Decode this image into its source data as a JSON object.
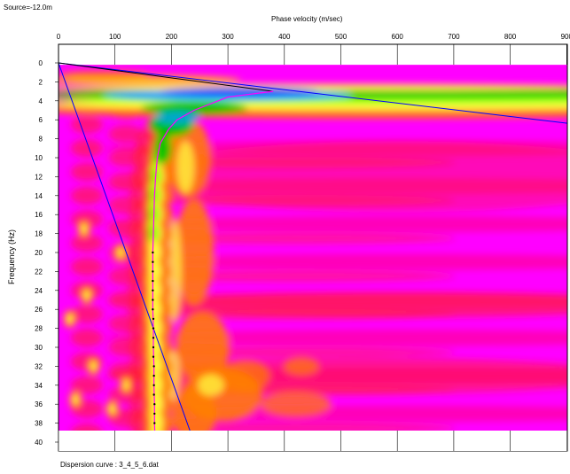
{
  "header": {
    "source_label": "Source=-12.0m"
  },
  "footer": {
    "dispersion_label": "Dispersion curve : 3_4_5_6.dat"
  },
  "chart_data": {
    "type": "heatmap",
    "title": "",
    "xlabel": "Phase velocity (m/sec)",
    "ylabel": "Frequency (Hz)",
    "xlim": [
      0,
      920
    ],
    "ylim": [
      0,
      40
    ],
    "x_ticks": [
      0,
      100,
      200,
      300,
      400,
      500,
      600,
      700,
      800,
      900
    ],
    "y_ticks": [
      0,
      2,
      4,
      6,
      8,
      10,
      12,
      14,
      16,
      18,
      20,
      22,
      24,
      26,
      28,
      30,
      32,
      34,
      36,
      38,
      40
    ],
    "y_inverted": true,
    "colormap": [
      "#ff00ff",
      "#ff0080",
      "#ff2030",
      "#ff8000",
      "#ffc800",
      "#ffff40",
      "#80ff00",
      "#00c000",
      "#00a0ff",
      "#0000ff"
    ],
    "colors": {
      "dispersion_curve": "#ff00ff",
      "picked_points": "#000000",
      "aliasing_lines": "#0000ff",
      "dark_line": "#000000"
    },
    "fundamental_mode": {
      "name": "Dispersion curve",
      "points": [
        [
          380,
          3
        ],
        [
          300,
          3.6
        ],
        [
          240,
          5
        ],
        [
          210,
          6
        ],
        [
          195,
          7
        ],
        [
          180,
          8.5
        ],
        [
          175,
          10
        ],
        [
          172,
          12
        ],
        [
          170,
          14
        ],
        [
          169,
          16
        ],
        [
          168,
          18
        ],
        [
          167,
          20
        ],
        [
          167,
          22
        ],
        [
          167,
          24
        ],
        [
          167,
          26
        ],
        [
          168,
          28
        ],
        [
          168,
          30
        ],
        [
          169,
          32
        ],
        [
          169,
          34
        ],
        [
          170,
          36
        ],
        [
          170,
          38
        ],
        [
          171,
          40
        ]
      ]
    },
    "picked_points": [
      [
        167,
        20
      ],
      [
        167,
        21
      ],
      [
        167,
        22
      ],
      [
        167,
        23
      ],
      [
        167,
        24
      ],
      [
        167,
        25
      ],
      [
        167,
        26
      ],
      [
        168,
        27
      ],
      [
        168,
        28
      ],
      [
        168,
        29
      ],
      [
        168,
        30
      ],
      [
        168,
        31
      ],
      [
        169,
        32
      ],
      [
        169,
        33
      ],
      [
        169,
        34
      ],
      [
        169,
        35
      ],
      [
        170,
        36
      ],
      [
        170,
        37
      ],
      [
        170,
        38
      ]
    ],
    "aliasing_lines": [
      {
        "from": [
          0,
          0
        ],
        "to": [
          920,
          6.5
        ]
      },
      {
        "from": [
          0,
          0
        ],
        "to": [
          240,
          40
        ]
      }
    ]
  }
}
